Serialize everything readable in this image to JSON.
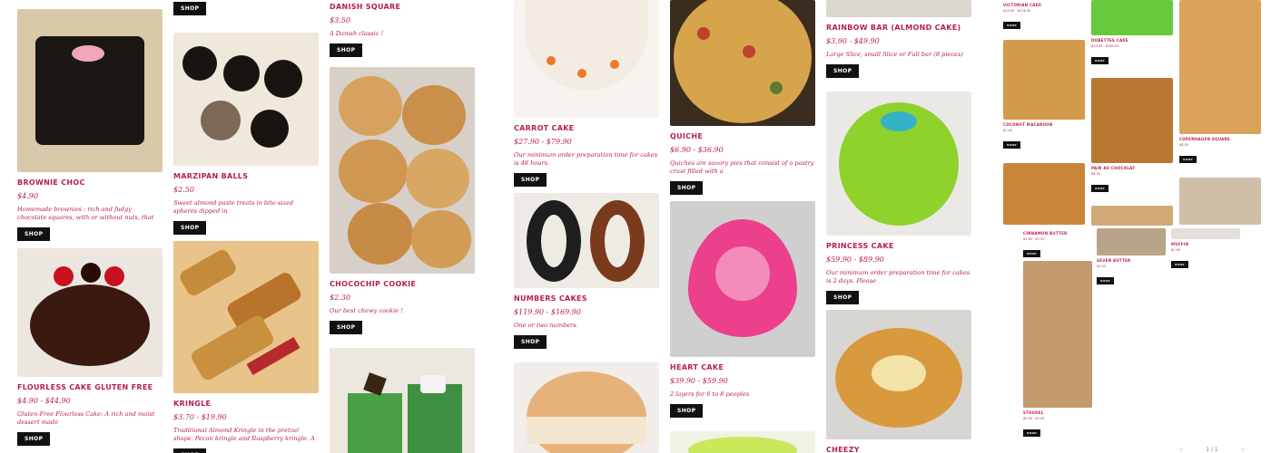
{
  "shop_label": "SHOP",
  "columns": [
    {
      "cards": [
        {
          "title": "Brownie Choc",
          "price": "$4.90",
          "desc": "Homemade brownies : rich and fudgy chocolate squares, with or without nuts, that melt in your mouth."
        },
        {
          "title": "Flourless Cake Gluten Free",
          "price": "$4.90 - $44.90",
          "desc": "Gluten-Free Flourless Cake: A rich and moist dessert made"
        }
      ]
    },
    {
      "cards": [
        {
          "title": "Marzipan Balls",
          "price": "$2.50",
          "desc": "Sweet almond paste treats in bite-sized spheres dipped in"
        },
        {
          "title": "Kringle",
          "price": "$3.70 - $19.90",
          "desc": "Traditional Almond Kringle in the pretzel shape. Pecan kringle and Raspberry kringle. A flaky and buttery pastry with a"
        }
      ]
    },
    {
      "cards": [
        {
          "title": "Danish Square",
          "price": "$3.50",
          "desc": "A Danish classic !"
        },
        {
          "title": "Chocochip Cookie",
          "price": "$2.30",
          "desc": "Our best chewy cookie !"
        }
      ]
    },
    {
      "cards": [
        {
          "title": "Carrot Cake",
          "price": "$27.90 - $79.90",
          "desc": "Our minimum order preparation time for cakes is 48 hours."
        },
        {
          "title": "Numbers Cakes",
          "price": "$119.90 - $169.90",
          "desc": "One or two numbers."
        }
      ]
    },
    {
      "cards": [
        {
          "title": "Quiche",
          "price": "$6.90 - $36.90",
          "desc": "Quiches are savory pies that consist of a pastry crust filled with a"
        },
        {
          "title": "Heart Cake",
          "price": "$39.90 - $59.90",
          "desc": "2 layers for 6 to 8 peoples"
        }
      ]
    },
    {
      "cards": [
        {
          "title": "Rainbow Bar (Almond Cake)",
          "price": "$3.90 - $49.90",
          "desc": "Large Slice, small Slice or Full bar (8 pieces)"
        },
        {
          "title": "Princess Cake",
          "price": "$59.90 - $89.90",
          "desc": "Our minimum order preparation time for cakes is 2 days. Please"
        },
        {
          "title": "Cheezy",
          "price": "",
          "desc": ""
        }
      ]
    }
  ],
  "minis": [
    {
      "title": "Victorian Cake",
      "price": "$39.90 - $124.90"
    },
    {
      "title": "Coconut Macaroon",
      "price": "$2.50"
    },
    {
      "title": "Dobettes Cake",
      "price": "$29.90 - $189.90"
    },
    {
      "title": "Pain au Chocolat",
      "price": "$4.50"
    },
    {
      "title": "Copenhagen Square",
      "price": "$4.50"
    },
    {
      "title": "Cinnamon Butter",
      "price": "$3.60 - $5.90"
    },
    {
      "title": "Seven Butter",
      "price": "$3.50"
    },
    {
      "title": "Muffin",
      "price": "$2.90"
    },
    {
      "title": "Strudel",
      "price": "$3.60 - $5.90"
    }
  ],
  "pager": {
    "prev": "‹",
    "page": "1 / 1",
    "next": "›"
  }
}
